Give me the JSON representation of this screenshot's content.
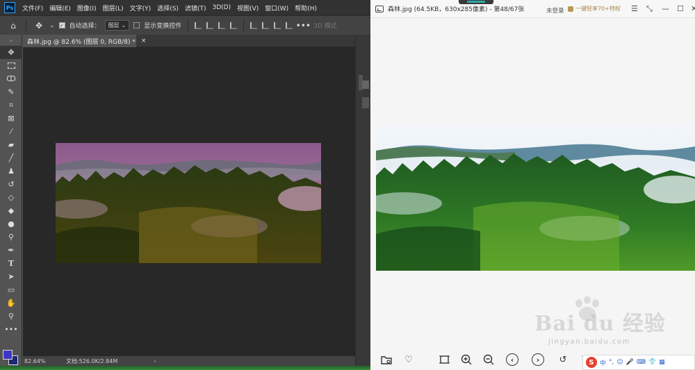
{
  "photoshop": {
    "logo": "Ps",
    "menu": [
      "文件(F)",
      "编辑(E)",
      "图像(I)",
      "图层(L)",
      "文字(Y)",
      "选择(S)",
      "滤镜(T)",
      "3D(D)",
      "视图(V)",
      "窗口(W)",
      "帮助(H)"
    ],
    "options": {
      "auto_select_label": "自动选择：",
      "layer_select": "图层",
      "show_transform_label": "显示变换控件",
      "mode_3d": "3D 模式"
    },
    "doc_tab": {
      "title": "森林.jpg @ 82.6% (图层 0, RGB/8) *",
      "close": "×"
    },
    "status": {
      "zoom": "82.64%",
      "doc": "文档:526.0K/2.84M",
      "arrow": "›"
    },
    "colors": {
      "foreground": "#3e36c9",
      "background": "#1b2876"
    }
  },
  "viewer": {
    "title": "森林.jpg (64.5KB，630x285像素) - 第48/67张",
    "login": "未登录",
    "promo": "一键轻享70+特权",
    "window_controls": {
      "menu": "☰",
      "compact": "⤡",
      "minimize": "—",
      "maximize": "☐",
      "close": "✕"
    }
  },
  "ime": {
    "logo": "S",
    "lang": "中"
  },
  "watermark": {
    "brand": "Bai du 经验",
    "url": "jingyan.baidu.com"
  }
}
